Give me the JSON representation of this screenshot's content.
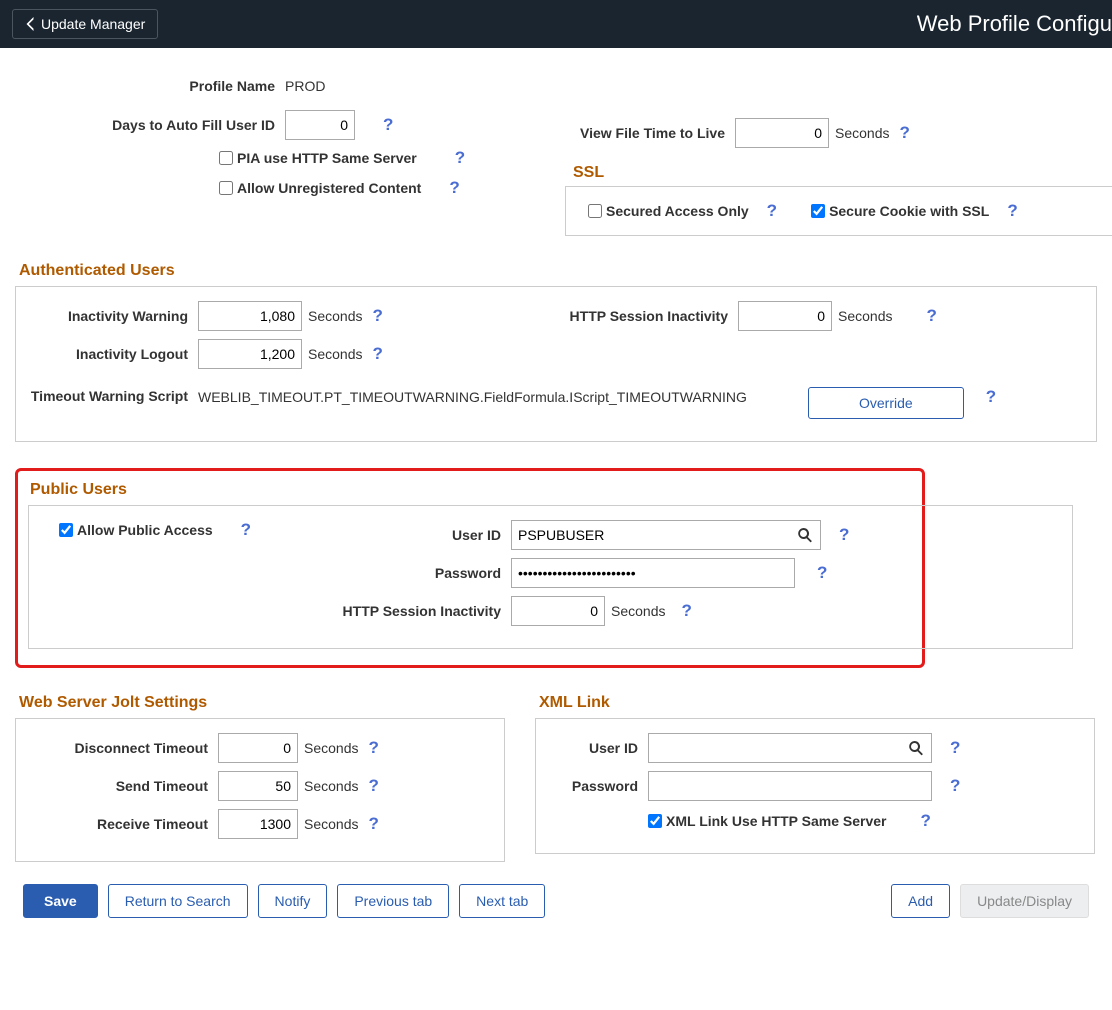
{
  "header": {
    "back_label": "Update Manager",
    "page_title": "Web Profile Configu"
  },
  "profile": {
    "label_profile_name": "Profile Name",
    "profile_name": "PROD",
    "label_days_autofill": "Days to Auto Fill User ID",
    "days_autofill": "0",
    "label_pia_same_server": "PIA use HTTP Same Server",
    "label_allow_unreg": "Allow Unregistered Content",
    "label_view_file_ttl": "View File Time to Live",
    "view_file_ttl": "0",
    "unit_seconds": "Seconds"
  },
  "ssl": {
    "title": "SSL",
    "label_secured_only": "Secured Access Only",
    "label_secure_cookie": "Secure Cookie with SSL"
  },
  "auth": {
    "title": "Authenticated Users",
    "label_inactivity_warning": "Inactivity Warning",
    "inactivity_warning": "1,080",
    "label_inactivity_logout": "Inactivity Logout",
    "inactivity_logout": "1,200",
    "label_http_session": "HTTP Session Inactivity",
    "http_session": "0",
    "label_timeout_script": "Timeout Warning Script",
    "timeout_script": "WEBLIB_TIMEOUT.PT_TIMEOUTWARNING.FieldFormula.IScript_TIMEOUTWARNING",
    "override_label": "Override",
    "unit_seconds": "Seconds"
  },
  "public": {
    "title": "Public Users",
    "label_allow_public": "Allow Public Access",
    "label_user_id": "User ID",
    "user_id": "PSPUBUSER",
    "label_password": "Password",
    "password": "••••••••••••••••••••••••",
    "label_http_session": "HTTP Session Inactivity",
    "http_session": "0",
    "unit_seconds": "Seconds"
  },
  "jolt": {
    "title": "Web Server Jolt Settings",
    "label_disconnect": "Disconnect Timeout",
    "disconnect": "0",
    "label_send": "Send Timeout",
    "send": "50",
    "label_receive": "Receive Timeout",
    "receive": "1300",
    "unit_seconds": "Seconds"
  },
  "xml": {
    "title": "XML Link",
    "label_user_id": "User ID",
    "user_id": "",
    "label_password": "Password",
    "password": "",
    "label_same_server": "XML Link Use HTTP Same Server"
  },
  "footer": {
    "save": "Save",
    "return": "Return to Search",
    "notify": "Notify",
    "prev_tab": "Previous tab",
    "next_tab": "Next tab",
    "add": "Add",
    "update": "Update/Display"
  },
  "help_tooltip": "?"
}
